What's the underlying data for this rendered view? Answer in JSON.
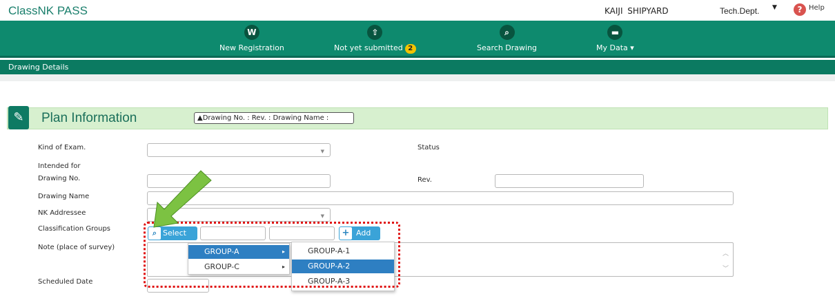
{
  "header": {
    "brand": "ClassNK PASS",
    "user": "KAIJI SHIPYARD",
    "dept": "Tech.Dept.",
    "help": "Help"
  },
  "nav": {
    "items": [
      {
        "label": "New Registration",
        "icon": "ship-wheel-icon"
      },
      {
        "label": "Not yet submitted",
        "icon": "upload-icon",
        "badge": "2"
      },
      {
        "label": "Search Drawing",
        "icon": "search-icon"
      },
      {
        "label": "My Data",
        "icon": "folder-icon"
      }
    ],
    "sub_title": "Drawing Details"
  },
  "plan": {
    "title": "Plan Information",
    "summary": "Drawing No. : Rev. : Drawing Name :"
  },
  "form": {
    "kind_of_exam": "Kind of Exam.",
    "intended_for": "Intended for",
    "drawing_no": "Drawing No.",
    "drawing_name": "Drawing Name",
    "nk_addressee": "NK Addressee",
    "classification_groups": "Classification Groups",
    "note": "Note (place of survey)",
    "scheduled_date": "Scheduled Date",
    "status": "Status",
    "rev": "Rev.",
    "select_button": "Select",
    "add_button": "Add"
  },
  "menu_groups": [
    "GROUP-A",
    "GROUP-C"
  ],
  "menu_subgroups": [
    "GROUP-A-1",
    "GROUP-A-2",
    "GROUP-A-3"
  ],
  "colors": {
    "primary_green": "#0e8a6e",
    "highlight_blue": "#2e7fc2",
    "button_blue": "#3aa3d8",
    "annotation_red": "#e01010",
    "arrow_green": "#7cc242"
  }
}
